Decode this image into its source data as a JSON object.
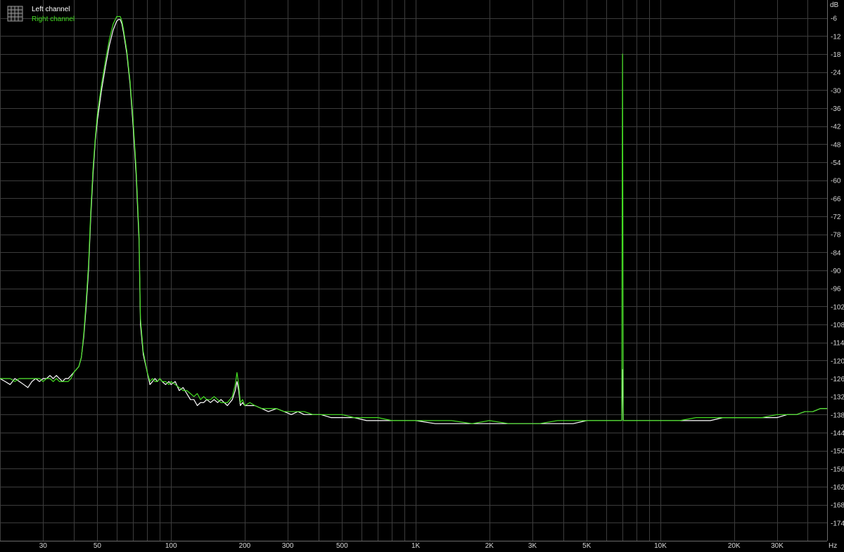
{
  "chart_data": {
    "type": "line",
    "x_scale": "log",
    "xlim": [
      20,
      48000
    ],
    "ylim": [
      -180,
      0
    ],
    "x_unit": "Hz",
    "y_unit": "dB",
    "grid": true,
    "legend_position": "top-left",
    "y_ticks": [
      -6,
      -12,
      -18,
      -24,
      -30,
      -36,
      -42,
      -48,
      -54,
      -60,
      -66,
      -72,
      -78,
      -84,
      -90,
      -96,
      -102,
      -108,
      -114,
      -120,
      -126,
      -132,
      -138,
      -144,
      -150,
      -156,
      -162,
      -168,
      -174
    ],
    "x_ticks": [
      {
        "value": 30,
        "label": "30"
      },
      {
        "value": 50,
        "label": "50"
      },
      {
        "value": 100,
        "label": "100"
      },
      {
        "value": 200,
        "label": "200"
      },
      {
        "value": 300,
        "label": "300"
      },
      {
        "value": 500,
        "label": "500"
      },
      {
        "value": 1000,
        "label": "1K"
      },
      {
        "value": 2000,
        "label": "2K"
      },
      {
        "value": 3000,
        "label": "3K"
      },
      {
        "value": 5000,
        "label": "5K"
      },
      {
        "value": 10000,
        "label": "10K"
      },
      {
        "value": 20000,
        "label": "20K"
      },
      {
        "value": 30000,
        "label": "30K"
      }
    ],
    "series": [
      {
        "name": "Left channel",
        "color": "#ffffff",
        "points": [
          [
            20,
            -126
          ],
          [
            21,
            -127
          ],
          [
            22,
            -128
          ],
          [
            23,
            -126
          ],
          [
            24,
            -127
          ],
          [
            25,
            -128
          ],
          [
            26,
            -129
          ],
          [
            27,
            -127
          ],
          [
            28,
            -126
          ],
          [
            29,
            -127
          ],
          [
            30,
            -126
          ],
          [
            31,
            -126
          ],
          [
            32,
            -125
          ],
          [
            33,
            -126
          ],
          [
            34,
            -125
          ],
          [
            35,
            -126
          ],
          [
            36,
            -127
          ],
          [
            37,
            -126
          ],
          [
            38,
            -126
          ],
          [
            39,
            -125
          ],
          [
            40,
            -124
          ],
          [
            41,
            -123
          ],
          [
            42,
            -122
          ],
          [
            43,
            -119
          ],
          [
            44,
            -112
          ],
          [
            45,
            -102
          ],
          [
            46,
            -90
          ],
          [
            47,
            -72
          ],
          [
            48,
            -58
          ],
          [
            49,
            -47
          ],
          [
            50,
            -40
          ],
          [
            52,
            -30
          ],
          [
            54,
            -22
          ],
          [
            56,
            -15
          ],
          [
            58,
            -10
          ],
          [
            60,
            -7
          ],
          [
            61,
            -6.5
          ],
          [
            62,
            -6.5
          ],
          [
            63,
            -8
          ],
          [
            64,
            -11
          ],
          [
            66,
            -18
          ],
          [
            68,
            -28
          ],
          [
            70,
            -42
          ],
          [
            72,
            -58
          ],
          [
            74,
            -80
          ],
          [
            75,
            -108
          ],
          [
            77,
            -118
          ],
          [
            80,
            -124
          ],
          [
            82,
            -128
          ],
          [
            84,
            -127
          ],
          [
            86,
            -126
          ],
          [
            88,
            -127
          ],
          [
            90,
            -126
          ],
          [
            92,
            -127
          ],
          [
            95,
            -128
          ],
          [
            98,
            -127
          ],
          [
            100,
            -128
          ],
          [
            104,
            -127
          ],
          [
            108,
            -130
          ],
          [
            112,
            -129
          ],
          [
            116,
            -131
          ],
          [
            120,
            -133
          ],
          [
            124,
            -133
          ],
          [
            128,
            -135
          ],
          [
            132,
            -134
          ],
          [
            136,
            -134
          ],
          [
            140,
            -133
          ],
          [
            145,
            -134
          ],
          [
            150,
            -133
          ],
          [
            155,
            -134
          ],
          [
            160,
            -133
          ],
          [
            170,
            -135
          ],
          [
            178,
            -133
          ],
          [
            183,
            -130
          ],
          [
            186,
            -127
          ],
          [
            189,
            -130
          ],
          [
            192,
            -135
          ],
          [
            196,
            -134
          ],
          [
            200,
            -135
          ],
          [
            210,
            -135
          ],
          [
            220,
            -135
          ],
          [
            235,
            -136
          ],
          [
            250,
            -137
          ],
          [
            270,
            -136
          ],
          [
            290,
            -137
          ],
          [
            310,
            -138
          ],
          [
            330,
            -137
          ],
          [
            350,
            -138
          ],
          [
            380,
            -138
          ],
          [
            410,
            -138
          ],
          [
            450,
            -139
          ],
          [
            500,
            -139
          ],
          [
            560,
            -139
          ],
          [
            630,
            -140
          ],
          [
            700,
            -140
          ],
          [
            800,
            -140
          ],
          [
            900,
            -140
          ],
          [
            1000,
            -140
          ],
          [
            1200,
            -141
          ],
          [
            1400,
            -141
          ],
          [
            1700,
            -141
          ],
          [
            2000,
            -141
          ],
          [
            2400,
            -141
          ],
          [
            2800,
            -141
          ],
          [
            3200,
            -141
          ],
          [
            3800,
            -141
          ],
          [
            4400,
            -141
          ],
          [
            5000,
            -140
          ],
          [
            5600,
            -140
          ],
          [
            6000,
            -140
          ],
          [
            6500,
            -140
          ],
          [
            6950,
            -140
          ],
          [
            6980,
            -128
          ],
          [
            7000,
            -123
          ],
          [
            7020,
            -130
          ],
          [
            7050,
            -140
          ],
          [
            7500,
            -140
          ],
          [
            8000,
            -140
          ],
          [
            9000,
            -140
          ],
          [
            10000,
            -140
          ],
          [
            12000,
            -140
          ],
          [
            14000,
            -140
          ],
          [
            16000,
            -140
          ],
          [
            18000,
            -139
          ],
          [
            20000,
            -139
          ],
          [
            23000,
            -139
          ],
          [
            26000,
            -139
          ],
          [
            30000,
            -139
          ],
          [
            33000,
            -138
          ],
          [
            36000,
            -138
          ],
          [
            39000,
            -137
          ],
          [
            42000,
            -137
          ],
          [
            45000,
            -136
          ],
          [
            48000,
            -136
          ]
        ]
      },
      {
        "name": "Right channel",
        "color": "#44dd22",
        "points": [
          [
            20,
            -126
          ],
          [
            21,
            -126
          ],
          [
            22,
            -126
          ],
          [
            23,
            -127
          ],
          [
            24,
            -126
          ],
          [
            25,
            -126
          ],
          [
            26,
            -126
          ],
          [
            27,
            -126
          ],
          [
            28,
            -126
          ],
          [
            29,
            -126
          ],
          [
            30,
            -127
          ],
          [
            31,
            -126
          ],
          [
            32,
            -126
          ],
          [
            33,
            -127
          ],
          [
            34,
            -126
          ],
          [
            35,
            -127
          ],
          [
            36,
            -127
          ],
          [
            37,
            -127
          ],
          [
            38,
            -127
          ],
          [
            39,
            -126
          ],
          [
            40,
            -124
          ],
          [
            41,
            -123
          ],
          [
            42,
            -122
          ],
          [
            43,
            -119
          ],
          [
            44,
            -111
          ],
          [
            45,
            -100
          ],
          [
            46,
            -88
          ],
          [
            47,
            -70
          ],
          [
            48,
            -56
          ],
          [
            49,
            -46
          ],
          [
            50,
            -38
          ],
          [
            52,
            -28
          ],
          [
            54,
            -20
          ],
          [
            56,
            -13
          ],
          [
            58,
            -8
          ],
          [
            60,
            -5.5
          ],
          [
            61,
            -5.5
          ],
          [
            62,
            -5.5
          ],
          [
            63,
            -7
          ],
          [
            64,
            -10
          ],
          [
            66,
            -17
          ],
          [
            68,
            -27
          ],
          [
            70,
            -40
          ],
          [
            72,
            -56
          ],
          [
            74,
            -78
          ],
          [
            75,
            -106
          ],
          [
            77,
            -117
          ],
          [
            80,
            -124
          ],
          [
            82,
            -127
          ],
          [
            84,
            -126
          ],
          [
            86,
            -127
          ],
          [
            88,
            -127
          ],
          [
            90,
            -126
          ],
          [
            92,
            -127
          ],
          [
            95,
            -127
          ],
          [
            98,
            -128
          ],
          [
            100,
            -127
          ],
          [
            104,
            -128
          ],
          [
            108,
            -129
          ],
          [
            112,
            -130
          ],
          [
            116,
            -130
          ],
          [
            120,
            -131
          ],
          [
            124,
            -132
          ],
          [
            128,
            -131
          ],
          [
            132,
            -133
          ],
          [
            136,
            -132
          ],
          [
            140,
            -133
          ],
          [
            145,
            -133
          ],
          [
            150,
            -132
          ],
          [
            155,
            -133
          ],
          [
            160,
            -134
          ],
          [
            170,
            -134
          ],
          [
            178,
            -132
          ],
          [
            183,
            -128
          ],
          [
            186,
            -124
          ],
          [
            189,
            -128
          ],
          [
            192,
            -134
          ],
          [
            196,
            -133
          ],
          [
            200,
            -135
          ],
          [
            210,
            -134
          ],
          [
            220,
            -135
          ],
          [
            235,
            -136
          ],
          [
            250,
            -136
          ],
          [
            270,
            -136
          ],
          [
            290,
            -137
          ],
          [
            310,
            -137
          ],
          [
            330,
            -137
          ],
          [
            350,
            -137
          ],
          [
            380,
            -138
          ],
          [
            410,
            -138
          ],
          [
            450,
            -138
          ],
          [
            500,
            -138
          ],
          [
            560,
            -139
          ],
          [
            630,
            -139
          ],
          [
            700,
            -139
          ],
          [
            800,
            -140
          ],
          [
            900,
            -140
          ],
          [
            1000,
            -140
          ],
          [
            1200,
            -140
          ],
          [
            1400,
            -140
          ],
          [
            1700,
            -141
          ],
          [
            2000,
            -140
          ],
          [
            2400,
            -141
          ],
          [
            2800,
            -141
          ],
          [
            3200,
            -141
          ],
          [
            3800,
            -140
          ],
          [
            4400,
            -140
          ],
          [
            5000,
            -140
          ],
          [
            5600,
            -140
          ],
          [
            6000,
            -140
          ],
          [
            6500,
            -140
          ],
          [
            6950,
            -140
          ],
          [
            6980,
            -60
          ],
          [
            7000,
            -18
          ],
          [
            7020,
            -60
          ],
          [
            7050,
            -140
          ],
          [
            7500,
            -140
          ],
          [
            8000,
            -140
          ],
          [
            9000,
            -140
          ],
          [
            10000,
            -140
          ],
          [
            12000,
            -140
          ],
          [
            14000,
            -139
          ],
          [
            16000,
            -139
          ],
          [
            18000,
            -139
          ],
          [
            20000,
            -139
          ],
          [
            23000,
            -139
          ],
          [
            26000,
            -139
          ],
          [
            30000,
            -138
          ],
          [
            33000,
            -138
          ],
          [
            36000,
            -138
          ],
          [
            39000,
            -137
          ],
          [
            42000,
            -137
          ],
          [
            45000,
            -136
          ],
          [
            48000,
            -136
          ]
        ]
      }
    ]
  }
}
